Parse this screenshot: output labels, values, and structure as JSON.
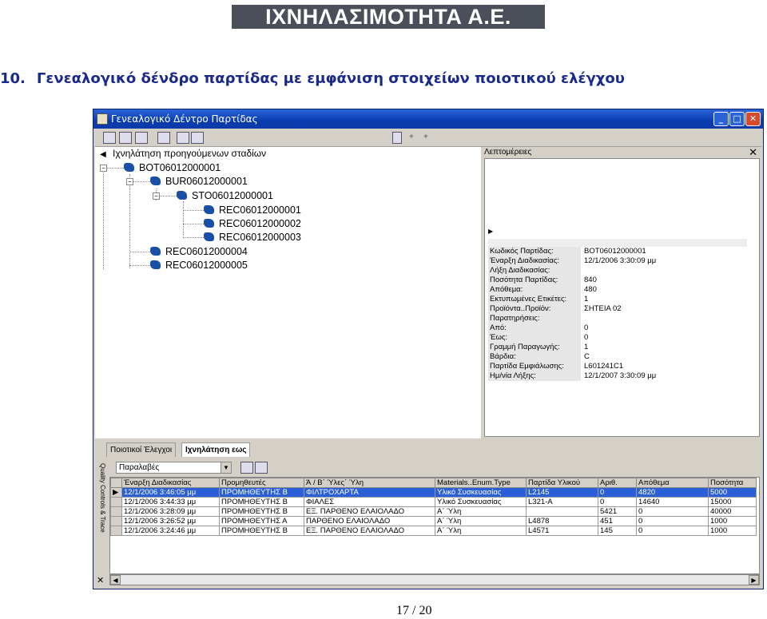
{
  "banner": "ΙΧΝΗΛΑΣΙΜΟΤΗΤΑ Α.Ε.",
  "heading": {
    "number": "10.",
    "text": "Γενεαλογικό δένδρο παρτίδας με εμφάνιση στοιχείων ποιοτικού ελέγχου"
  },
  "window": {
    "title": "Γενεαλογικό Δέντρο Παρτίδας",
    "min": "_",
    "max": "□",
    "close": "✕"
  },
  "tree": {
    "header": "Ιχνηλάτηση προηγούμενων σταδίων",
    "nodes": [
      "BOT06012000001",
      "BUR06012000001",
      "STO06012000001",
      "REC06012000001",
      "REC06012000002",
      "REC06012000003",
      "REC06012000004",
      "REC06012000005"
    ]
  },
  "details": {
    "header": "Λεπτομέρειες",
    "close": "✕",
    "props": [
      {
        "k": "Κωδικός Παρτίδας:",
        "v": "BOT06012000001"
      },
      {
        "k": "Έναρξη Διαδικασίας:",
        "v": "12/1/2006 3:30:09 μμ"
      },
      {
        "k": "Λήξη Διαδικασίας:",
        "v": ""
      },
      {
        "k": "Ποσότητα Παρτίδας:",
        "v": "840"
      },
      {
        "k": "Απόθεμα:",
        "v": "480"
      },
      {
        "k": "Εκτυπωμένες Ετικέτες:",
        "v": "1"
      },
      {
        "k": "Προϊόντα..Προϊόν:",
        "v": "ΣΗΤΕΙΑ 02"
      },
      {
        "k": "Παρατηρήσεις:",
        "v": ""
      },
      {
        "k": "Από:",
        "v": "0"
      },
      {
        "k": "Έως:",
        "v": "0"
      },
      {
        "k": "Γραμμή Παραγωγής:",
        "v": "1"
      },
      {
        "k": "Βάρδια:",
        "v": "C"
      },
      {
        "k": "Παρτίδα Εμφιάλωσης:",
        "v": "L601241C1"
      },
      {
        "k": "Ημ/νία Λήξης:",
        "v": "12/1/2007 3:30:09 μμ"
      }
    ]
  },
  "bottom": {
    "tabs": [
      "Ποιοτικοί Έλεγχοι",
      "Ιχνηλάτηση εως"
    ],
    "side_label": "Quality Controls & Trace",
    "select": "Παραλαβές",
    "columns": [
      "Έναρξη Διαδικασίας",
      "Προμηθευτές",
      "Ά / Β΄ Ύλες΄ Ύλη",
      "Materials..Enum.Type",
      "Παρτίδα Υλικού",
      "Αριθ.",
      "Απόθεμα",
      "Ποσότητα"
    ],
    "rows": [
      [
        "12/1/2006 3:46:05 μμ",
        "ΠΡΟΜΗΘΕΥΤΗΣ Β",
        "ΦΙΛΤΡΟΧΑΡΤΑ",
        "Υλικό Συσκευασίας",
        "L2145",
        "0",
        "4820",
        "5000"
      ],
      [
        "12/1/2006 3:44:33 μμ",
        "ΠΡΟΜΗΘΕΥΤΗΣ Β",
        "ΦΙΑΛΕΣ",
        "Υλικό Συσκευασίας",
        "L321-A",
        "0",
        "14640",
        "15000"
      ],
      [
        "12/1/2006 3:28:09 μμ",
        "ΠΡΟΜΗΘΕΥΤΗΣ Β",
        "ΕΞ. ΠΑΡΘΕΝΟ ΕΛΑΙΟΛΑΔΟ",
        "Α΄ Ύλη",
        "",
        "5421",
        "0",
        "40000"
      ],
      [
        "12/1/2006 3:26:52 μμ",
        "ΠΡΟΜΗΘΕΥΤΗΣ Α",
        "ΠΑΡΘΕΝΟ ΕΛΑΙΟΛΑΔΟ",
        "Α΄ Ύλη",
        "L4878",
        "451",
        "0",
        "1000"
      ],
      [
        "12/1/2006 3:24:46 μμ",
        "ΠΡΟΜΗΘΕΥΤΗΣ Β",
        "ΕΞ. ΠΑΡΘΕΝΟ ΕΛΑΙΟΛΑΔΟ",
        "Α΄ Ύλη",
        "L4571",
        "145",
        "0",
        "1000"
      ]
    ]
  },
  "footer": "17 / 20"
}
